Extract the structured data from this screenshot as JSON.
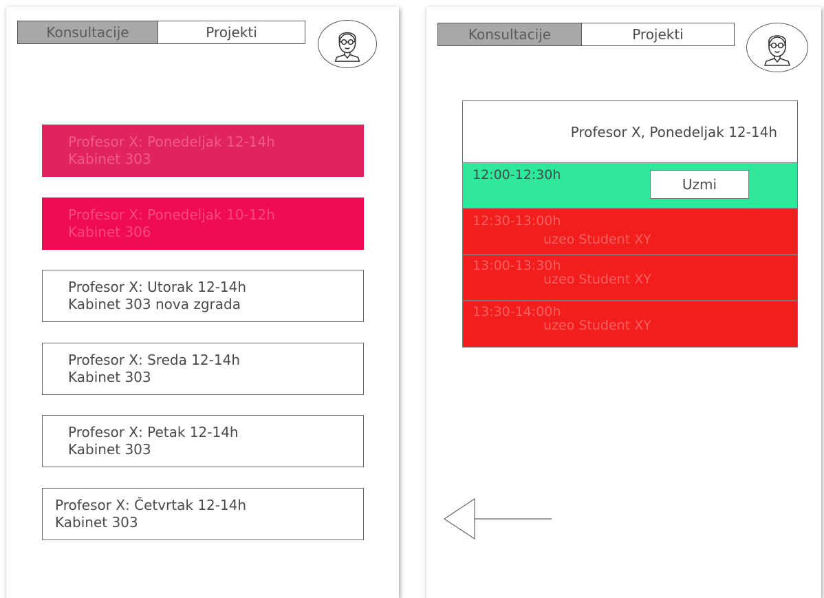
{
  "screen_list": {
    "tabs": [
      {
        "label": "Konsultacije",
        "active": true
      },
      {
        "label": "Projekti",
        "active": false
      }
    ],
    "avatar_icon": "user-avatar-icon",
    "consultations": [
      {
        "line1": "Profesor X: Ponedeljak 12-14h",
        "line2": "Kabinet 303",
        "bg": "#e0245e",
        "text_color": "#f25a86"
      },
      {
        "line1": "Profesor X: Ponedeljak 10-12h",
        "line2": "Kabinet 306",
        "bg": "#f00c52",
        "text_color": "#f7487e"
      },
      {
        "line1": "Profesor X: Utorak 12-14h",
        "line2": "Kabinet 303 nova zgrada",
        "bg": "#ffffff",
        "text_color": "#4a4a4a"
      },
      {
        "line1": "Profesor X: Sreda 12-14h",
        "line2": "Kabinet 303",
        "bg": "#ffffff",
        "text_color": "#4a4a4a"
      },
      {
        "line1": "Profesor X: Petak 12-14h",
        "line2": "Kabinet 303",
        "bg": "#ffffff",
        "text_color": "#4a4a4a"
      },
      {
        "line1": "Profesor X: Četvrtak 12-14h",
        "line2": "Kabinet 303",
        "bg": "#ffffff",
        "text_color": "#4a4a4a"
      }
    ]
  },
  "screen_detail": {
    "tabs": [
      {
        "label": "Konsultacije",
        "active": true
      },
      {
        "label": "Projekti",
        "active": false
      }
    ],
    "avatar_icon": "user-avatar-icon",
    "header": "Profesor X, Ponedeljak 12-14h",
    "slots": [
      {
        "time": "12:00-12:30h",
        "status": "free",
        "button": "Uzmi",
        "bg": "#2fe89c",
        "text_color": "#4a4a4a"
      },
      {
        "time": "12:30-13:00h",
        "status": "taken",
        "taken_by": "uzeo Student XY",
        "bg": "#f21d1d",
        "text_color": "#f86060"
      },
      {
        "time": "13:00-13:30h",
        "status": "taken",
        "taken_by": "uzeo Student XY",
        "bg": "#f21d1d",
        "text_color": "#f86060"
      },
      {
        "time": "13:30-14:00h",
        "status": "taken",
        "taken_by": "uzeo Student XY",
        "bg": "#f21d1d",
        "text_color": "#f86060"
      }
    ],
    "back_icon": "arrow-left-icon"
  }
}
